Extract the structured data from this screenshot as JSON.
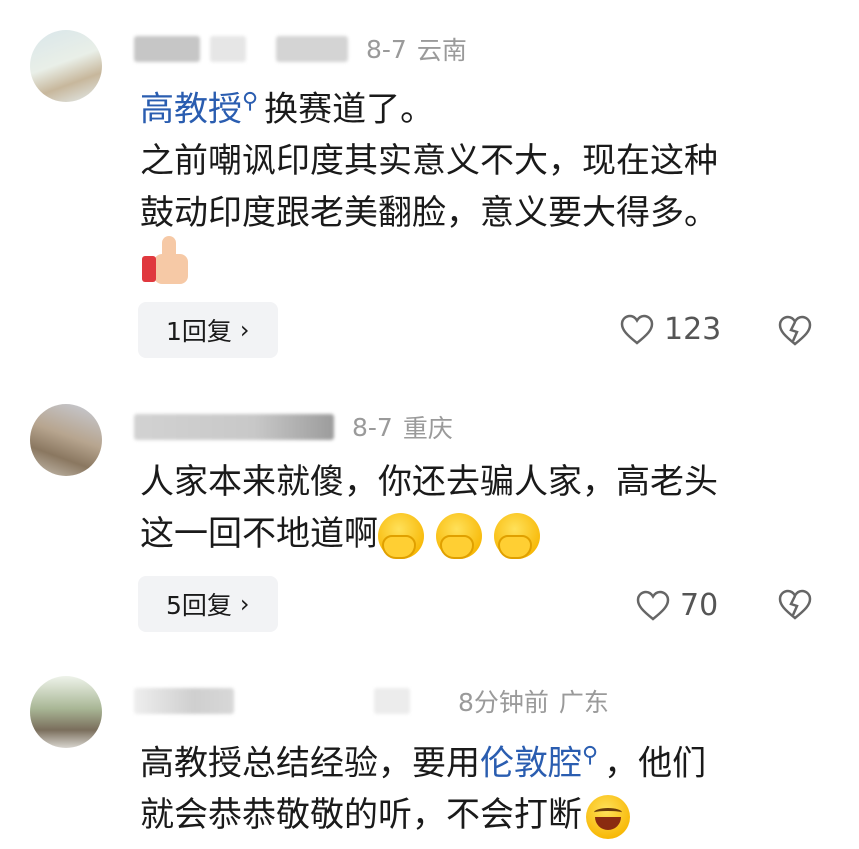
{
  "comments": [
    {
      "date": "8-7",
      "location": "云南",
      "mention": "高教授",
      "lines": [
        "换赛道了。",
        "之前嘲讽印度其实意义不大，现在这种",
        "鼓动印度跟老美翻脸，意义要大得多。"
      ],
      "reply_label": "1回复",
      "likes": "123"
    },
    {
      "date": "8-7",
      "location": "重庆",
      "lines": [
        "人家本来就傻，你还去骗人家，高老头",
        "这一回不地道啊"
      ],
      "reply_label": "5回复",
      "likes": "70"
    },
    {
      "date": "8分钟前",
      "location": "广东",
      "line1_prefix": "高教授总结经验，要用",
      "mention": "伦敦腔",
      "line1_suffix": "，他们",
      "line2": "就会恭恭敬敬的听，不会打断"
    }
  ],
  "icons": {
    "search": "search-icon",
    "chevron": "chevron-right-icon",
    "like": "heart-icon",
    "dislike": "broken-heart-icon"
  },
  "colors": {
    "link": "#2a5db0",
    "meta": "#9a9a9a",
    "reply_bg": "#f2f3f5"
  }
}
